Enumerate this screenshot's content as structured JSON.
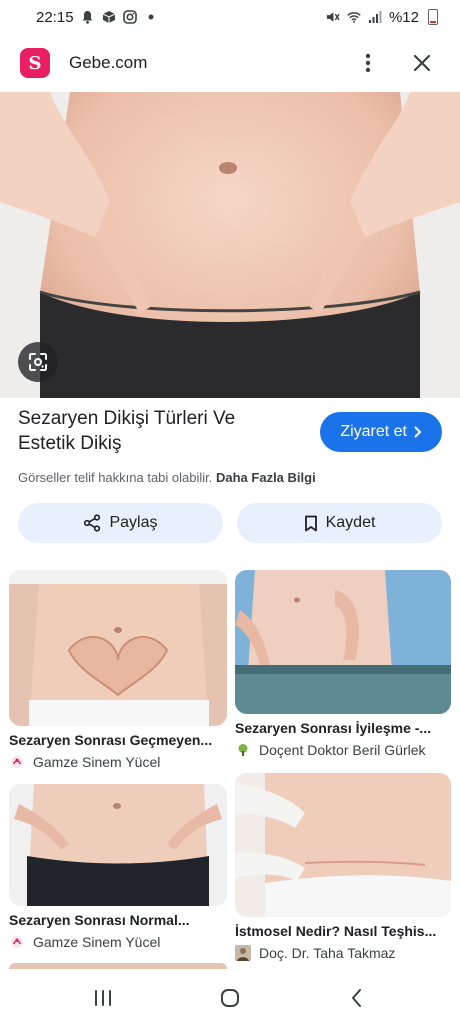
{
  "status_bar": {
    "time": "22:15",
    "left_icons": [
      "notification-bell-icon",
      "package-icon",
      "instagram-icon",
      "dot-icon"
    ],
    "right_icons": [
      "mute-icon",
      "wifi-icon",
      "signal-icon"
    ],
    "battery": "%12"
  },
  "header": {
    "site_name": "Gebe.com",
    "logo_letter": "S",
    "brand_color": "#e91e63"
  },
  "main": {
    "title": "Sezaryen Dikişi Türleri Ve Estetik Dikiş",
    "visit_label": "Ziyaret et",
    "copyright_text": "Görseller telif hakkına tabi olabilir.",
    "more_info": "Daha Fazla Bilgi",
    "accent_color": "#1a73e8"
  },
  "actions": {
    "share_label": "Paylaş",
    "save_label": "Kaydet"
  },
  "related": [
    {
      "title": "Sezaryen Sonrası Geçmeyen...",
      "source": "Gamze Sinem Yücel",
      "favicon": "gamze-favicon-icon"
    },
    {
      "title": "Sezaryen Sonrası İyileşme -...",
      "source": "Doçent Doktor Beril Gürlek",
      "favicon": "tree-favicon-icon"
    },
    {
      "title": "Sezaryen Sonrası Normal...",
      "source": "Gamze Sinem Yücel",
      "favicon": "gamze-favicon-icon"
    },
    {
      "title": "İstmosel Nedir? Nasıl Teşhis...",
      "source": "Doç. Dr. Taha Takmaz",
      "favicon": "doctor-photo-favicon-icon"
    }
  ],
  "navbar": {
    "icons": [
      "recent-apps-icon",
      "home-icon",
      "back-icon"
    ]
  }
}
